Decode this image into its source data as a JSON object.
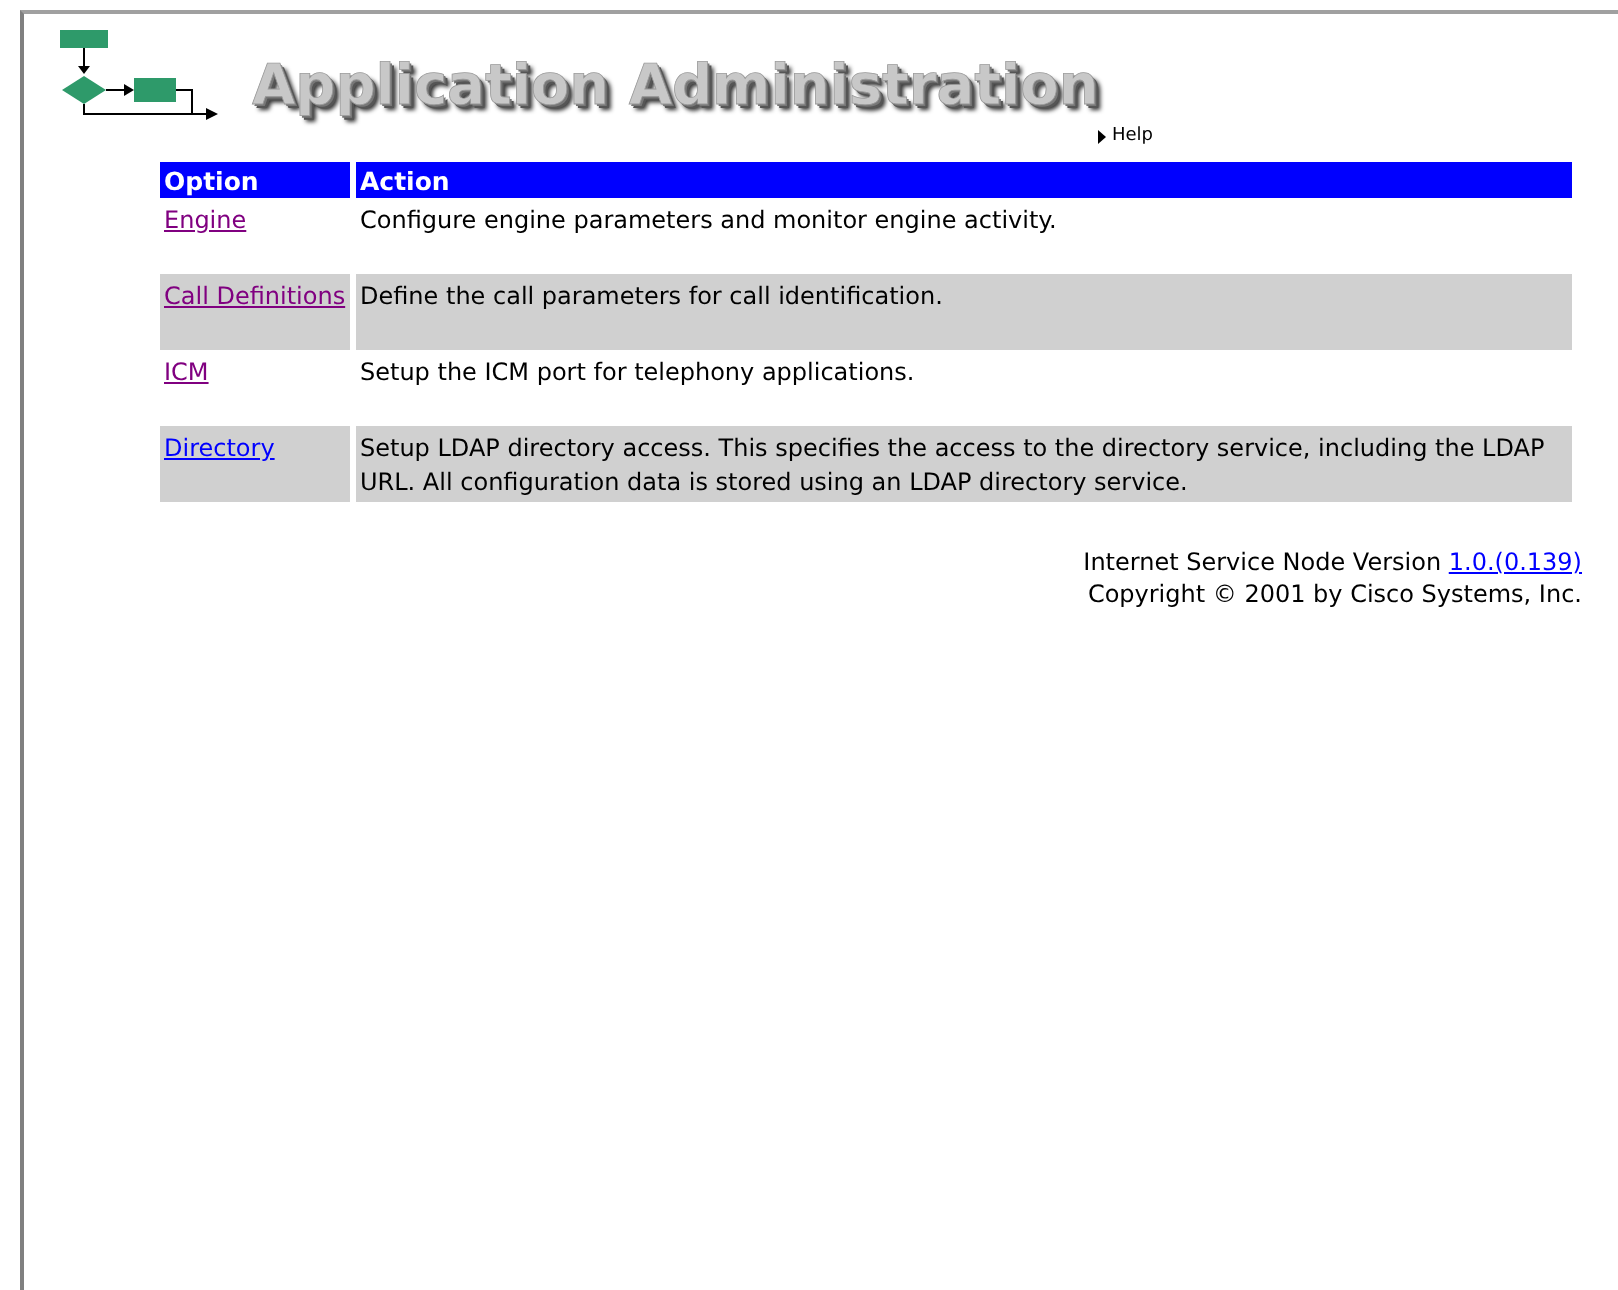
{
  "header": {
    "title": "Application Administration",
    "help_link": "Help"
  },
  "table": {
    "columns": [
      "Option",
      "Action"
    ],
    "rows": [
      {
        "option": "Engine",
        "visited": true,
        "action": "Configure engine parameters and monitor engine activity."
      },
      {
        "option": "Call Definitions",
        "visited": true,
        "action": "Define the call parameters for call identification."
      },
      {
        "option": "ICM",
        "visited": true,
        "action": "Setup the ICM port for telephony applications."
      },
      {
        "option": "Directory",
        "visited": false,
        "action": "Setup LDAP directory access. This specifies the access to the directory service, including the LDAP URL. All configuration data is stored using an LDAP directory service."
      }
    ]
  },
  "footer": {
    "version_label": "Internet Service Node Version",
    "version_link": "1.0.(0.139)",
    "copyright": "Copyright © 2001 by Cisco Systems, Inc."
  }
}
